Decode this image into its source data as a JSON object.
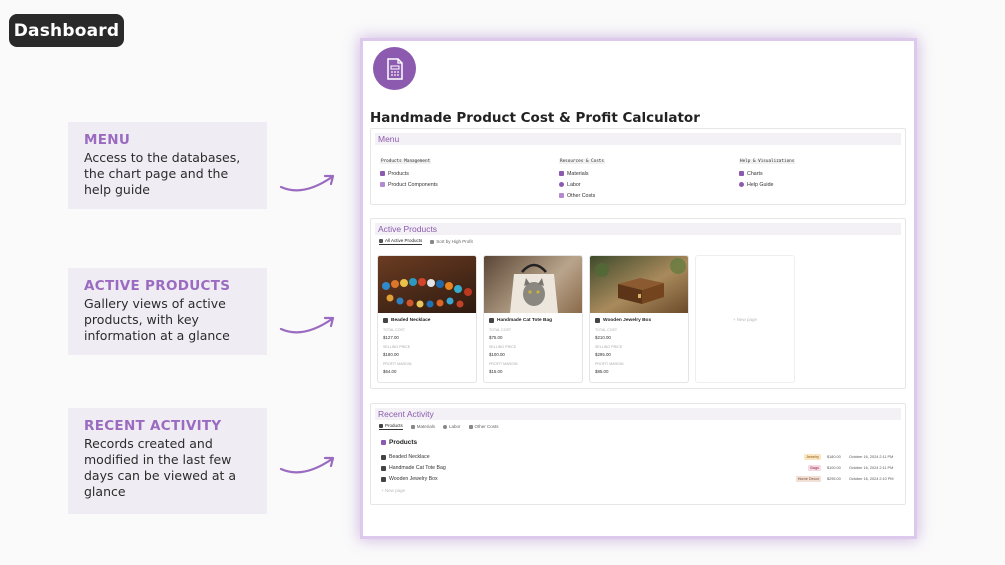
{
  "badge": "Dashboard",
  "callouts": [
    {
      "title": "MENU",
      "text": "Access to the databases, the chart page and the help guide"
    },
    {
      "title": "ACTIVE PRODUCTS",
      "text": "Gallery views of active products, with key information at a glance"
    },
    {
      "title": "RECENT ACTIVITY",
      "text": "Records created and modified in the last few days can be viewed at a glance"
    }
  ],
  "page": {
    "title": "Handmade Product Cost & Profit Calculator",
    "menu": {
      "heading": "Menu",
      "cols": [
        {
          "label": "Products Management",
          "items": [
            "Products",
            "Product Components"
          ]
        },
        {
          "label": "Resources & Costs",
          "items": [
            "Materials",
            "Labor",
            "Other Costs"
          ]
        },
        {
          "label": "Help & Visualizations",
          "items": [
            "Charts",
            "Help Guide"
          ]
        }
      ]
    },
    "active": {
      "heading": "Active Products",
      "tabs": [
        "All Active Products",
        "Sort by High Profit"
      ],
      "labels": {
        "cost": "TOTAL COST",
        "price": "SELLING PRICE",
        "margin": "PROFIT MARGIN"
      },
      "cards": [
        {
          "name": "Beaded Necklace",
          "cost": "$127.00",
          "price": "$180.00",
          "margin": "$64.00"
        },
        {
          "name": "Handmade Cat Tote Bag",
          "cost": "$75.00",
          "price": "$100.00",
          "margin": "$15.00"
        },
        {
          "name": "Wooden Jewelry Box",
          "cost": "$210.00",
          "price": "$295.00",
          "margin": "$85.00"
        }
      ],
      "new_page": "+ New page"
    },
    "recent": {
      "heading": "Recent Activity",
      "tabs": [
        "Products",
        "Materials",
        "Labor",
        "Other Costs"
      ],
      "sub_heading": "Products",
      "rows": [
        {
          "name": "Beaded Necklace",
          "tag": "Jewelry",
          "price": "$180.00",
          "date": "October 16, 2024 2:11 PM"
        },
        {
          "name": "Handmade Cat Tote Bag",
          "tag": "Bags",
          "price": "$100.00",
          "date": "October 16, 2024 2:11 PM"
        },
        {
          "name": "Wooden Jewelry Box",
          "tag": "Home Decor",
          "price": "$295.00",
          "date": "October 16, 2024 2:10 PM"
        }
      ],
      "new_page": "+ New page"
    }
  },
  "colors": {
    "accent": "#9a6bc0",
    "logo": "#8c5bb0"
  }
}
